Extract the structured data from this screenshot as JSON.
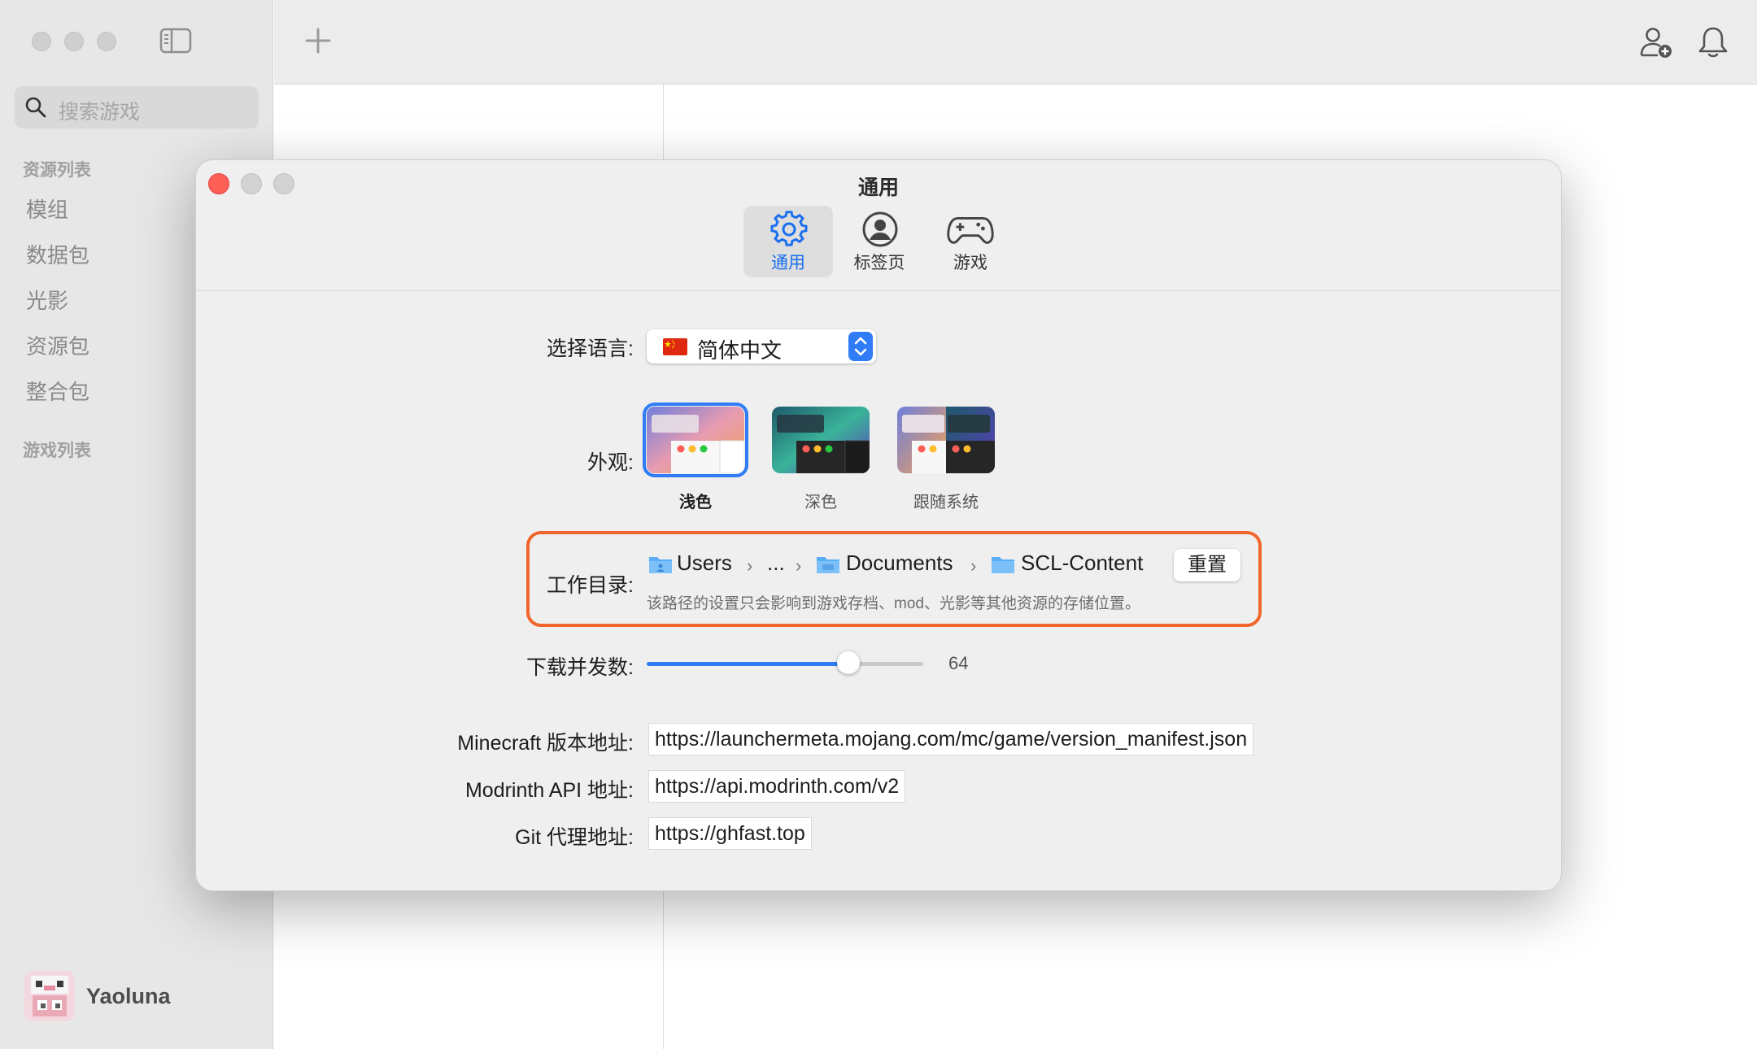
{
  "sidebar": {
    "search_placeholder": "搜索游戏",
    "resources_header": "资源列表",
    "items": [
      {
        "label": "模组"
      },
      {
        "label": "数据包"
      },
      {
        "label": "光影"
      },
      {
        "label": "资源包"
      },
      {
        "label": "整合包"
      }
    ],
    "games_header": "游戏列表",
    "user": {
      "name": "Yaoluna"
    }
  },
  "toolbar": {
    "icons": [
      "plus-icon",
      "add-person-icon",
      "bell-icon"
    ]
  },
  "settings": {
    "title": "通用",
    "tabs": [
      {
        "label": "通用",
        "icon": "gear-icon",
        "active": true
      },
      {
        "label": "标签页",
        "icon": "person-circle-icon",
        "active": false
      },
      {
        "label": "游戏",
        "icon": "gamepad-icon",
        "active": false
      }
    ],
    "language": {
      "label": "选择语言:",
      "value": "简体中文",
      "flag": "china-flag-icon"
    },
    "appearance": {
      "label": "外观:",
      "options": [
        {
          "label": "浅色",
          "selected": true
        },
        {
          "label": "深色",
          "selected": false
        },
        {
          "label": "跟随系统",
          "selected": false
        }
      ]
    },
    "workdir": {
      "label": "工作目录:",
      "path": [
        "Users",
        "...",
        "Documents",
        "SCL-Content"
      ],
      "reset_label": "重置",
      "hint": "该路径的设置只会影响到游戏存档、mod、光影等其他资源的存储位置。"
    },
    "downloads": {
      "label": "下载并发数:",
      "value": "64",
      "fraction": 0.73
    },
    "urls": [
      {
        "label": "Minecraft 版本地址:",
        "value": "https://launchermeta.mojang.com/mc/game/version_manifest.json"
      },
      {
        "label": "Modrinth API 地址:",
        "value": "https://api.modrinth.com/v2"
      },
      {
        "label": "Git 代理地址:",
        "value": "https://ghfast.top"
      }
    ]
  },
  "colors": {
    "accent": "#2f7cf6",
    "highlight": "#f0662c",
    "close": "#fe5f57"
  }
}
